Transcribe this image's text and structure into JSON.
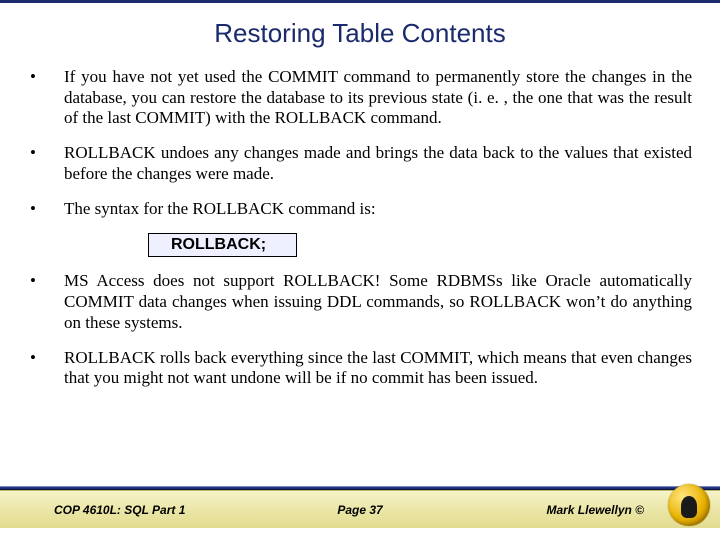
{
  "title": "Restoring Table Contents",
  "bullets": {
    "b1": "If you have not yet used the COMMIT command to permanently store the changes in the database, you can restore the database to its previous state (i. e. , the one that was the result of the last COMMIT) with the ROLLBACK command.",
    "b2": "ROLLBACK undoes any changes made and brings the data back to the values that existed before the changes were made.",
    "b3": "The syntax for the ROLLBACK command is:",
    "b4": "MS Access does not support ROLLBACK!  Some RDBMSs like Oracle automatically COMMIT data changes when issuing DDL commands, so ROLLBACK won’t do anything on these systems.",
    "b5": "ROLLBACK rolls back everything since the last COMMIT, which means that even changes that you might not want undone will be if no commit has been issued."
  },
  "syntax": "ROLLBACK;",
  "footer": {
    "course": "COP 4610L: SQL Part 1",
    "page": "Page 37",
    "author": "Mark Llewellyn ©"
  }
}
